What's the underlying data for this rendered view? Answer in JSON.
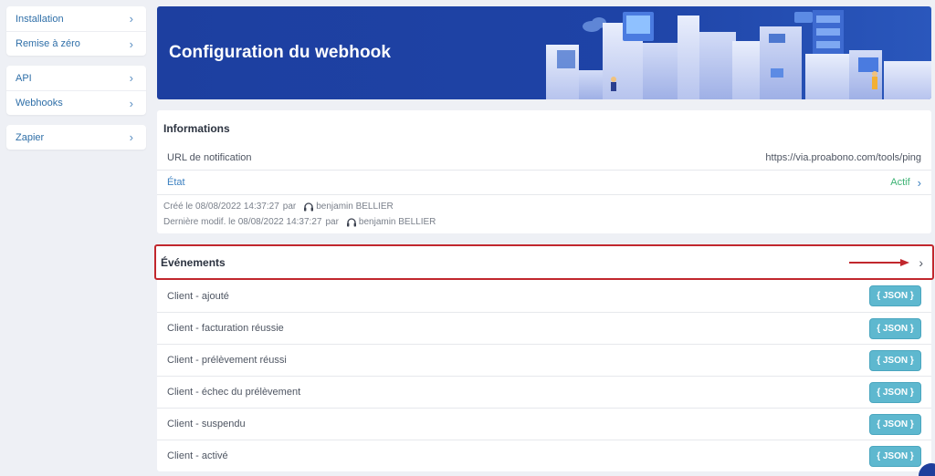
{
  "sidebar": {
    "groups": [
      {
        "items": [
          {
            "label": "Installation"
          },
          {
            "label": "Remise à zéro"
          }
        ]
      },
      {
        "items": [
          {
            "label": "API"
          },
          {
            "label": "Webhooks"
          }
        ]
      },
      {
        "items": [
          {
            "label": "Zapier"
          }
        ]
      }
    ]
  },
  "banner": {
    "title": "Configuration du webhook"
  },
  "info": {
    "title": "Informations",
    "url_label": "URL de notification",
    "url_value": "https://via.proabono.com/tools/ping",
    "state_label": "État",
    "state_value": "Actif",
    "created_label": "Créé  le 08/08/2022 14:37:27",
    "created_by_label": "par",
    "created_by": "benjamin BELLIER",
    "modified_label": "Dernière modif.  le 08/08/2022 14:37:27",
    "modified_by_label": "par",
    "modified_by": "benjamin BELLIER"
  },
  "events": {
    "title": "Événements",
    "json_label": "{ JSON }",
    "items": [
      {
        "label": "Client - ajouté"
      },
      {
        "label": "Client - facturation réussie"
      },
      {
        "label": "Client - prélèvement réussi"
      },
      {
        "label": "Client - échec du prélèvement"
      },
      {
        "label": "Client - suspendu"
      },
      {
        "label": "Client - activé"
      }
    ]
  },
  "colors": {
    "banner": "#1e43a6",
    "highlight_border": "#c1272d",
    "json_button": "#5eb8cf",
    "active_state": "#3bb273",
    "link": "#3a7fc0"
  }
}
